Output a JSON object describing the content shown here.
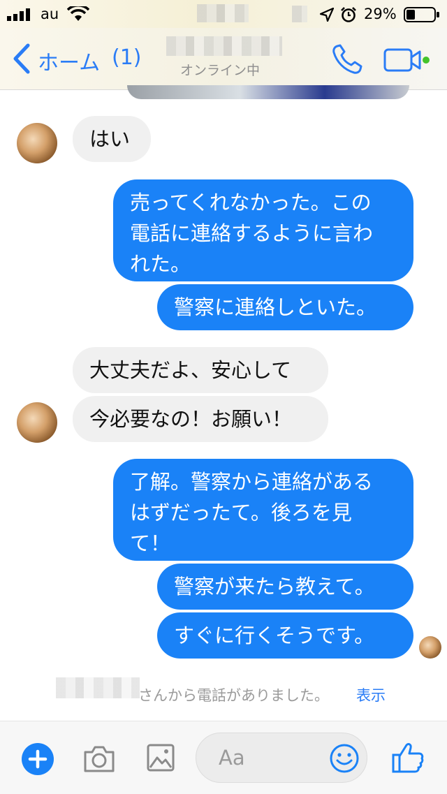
{
  "status_bar": {
    "carrier": "au",
    "battery_percent": "29%"
  },
  "nav": {
    "back_label": "ホーム",
    "back_count": "(1)",
    "subtitle": "オンライン中"
  },
  "messages": [
    {
      "id": "m1",
      "direction": "in",
      "text": "はい"
    },
    {
      "id": "m2",
      "direction": "out",
      "text": "売ってくれなかった。この\n電話に連絡するように言わ\nれた。"
    },
    {
      "id": "m3",
      "direction": "out",
      "text": "警察に連絡しといた。"
    },
    {
      "id": "m4",
      "direction": "in",
      "text": "大丈夫だよ、安心して"
    },
    {
      "id": "m5",
      "direction": "in",
      "text": "今必要なの！お願い！"
    },
    {
      "id": "m6",
      "direction": "out",
      "text": "了解。警察から連絡がある\nはずだったて。後ろを見\nて！"
    },
    {
      "id": "m7",
      "direction": "out",
      "text": "警察が来たら教えて。"
    },
    {
      "id": "m8",
      "direction": "out",
      "text": "すぐに行くそうです。"
    }
  ],
  "call_notice": {
    "text": "さんから電話がありました。",
    "link": "表示"
  },
  "composer": {
    "placeholder": "Aa"
  },
  "colors": {
    "accent": "#2a7cf6",
    "outgoing_bubble": "#1a82f7",
    "incoming_bubble": "#f0f0f0",
    "online_dot": "#44c32b"
  },
  "icons": [
    "signal-icon",
    "wifi-icon",
    "location-icon",
    "alarm-icon",
    "battery-icon",
    "back-chevron-icon",
    "phone-icon",
    "video-icon",
    "plus-icon",
    "camera-icon",
    "image-icon",
    "smiley-icon",
    "thumbs-up-icon"
  ]
}
